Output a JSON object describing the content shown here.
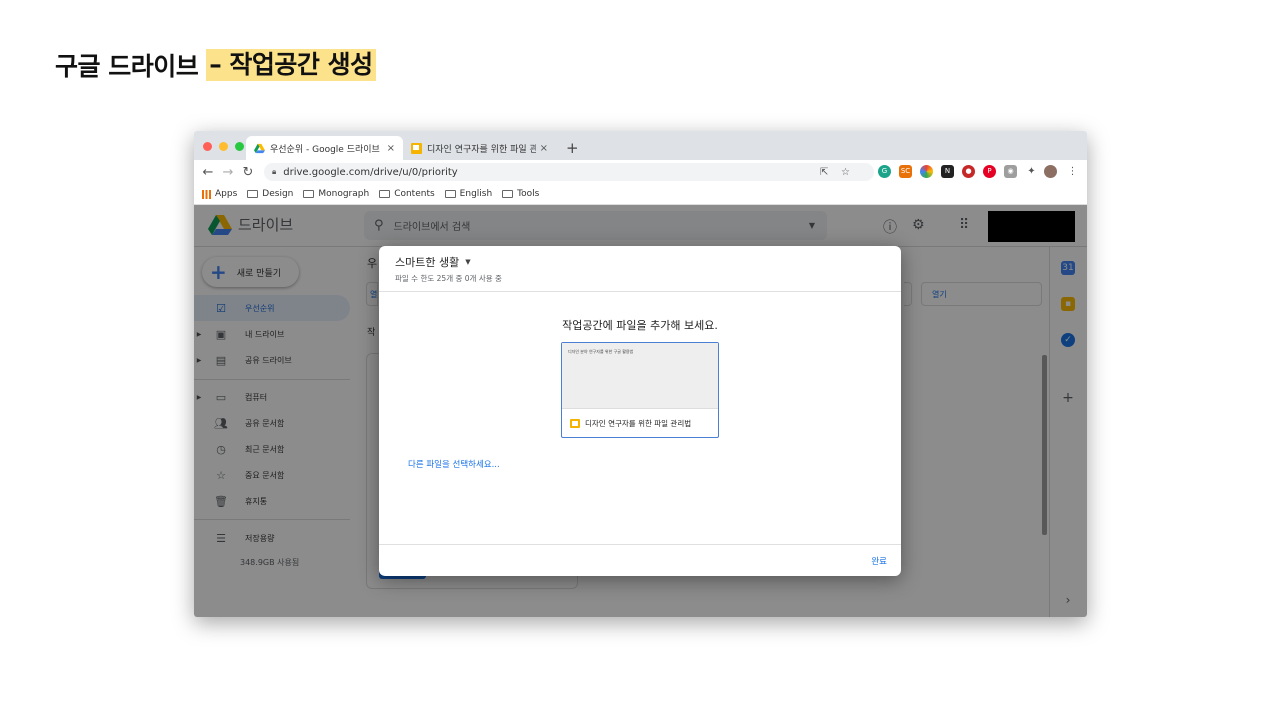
{
  "slide": {
    "title_prefix": "구글 드라이브",
    "title_highlight": "– 작업공간 생성"
  },
  "browser": {
    "tabs": [
      {
        "label": "우선순위 - Google 드라이브",
        "active": true
      },
      {
        "label": "디자인 연구자를 위한 파일 관리법 -",
        "active": false
      }
    ],
    "new_tab": "+",
    "close_glyph": "×",
    "url": "drive.google.com/drive/u/0/priority",
    "bookmarks": [
      "Apps",
      "Design",
      "Monograph",
      "Contents",
      "English",
      "Tools"
    ]
  },
  "drive": {
    "logo_text": "드라이브",
    "search_placeholder": "드라이브에서 검색",
    "new_button": "새로 만들기",
    "nav": [
      {
        "label": "우선순위",
        "icon": "priority-icon",
        "selected": true
      },
      {
        "label": "내 드라이브",
        "icon": "my-drive-icon"
      },
      {
        "label": "공유 드라이브",
        "icon": "shared-drive-icon"
      },
      {
        "label": "컴퓨터",
        "icon": "computer-icon"
      },
      {
        "label": "공유 문서함",
        "icon": "shared-with-me-icon"
      },
      {
        "label": "최근 문서함",
        "icon": "recent-icon"
      },
      {
        "label": "중요 문서함",
        "icon": "starred-icon"
      },
      {
        "label": "휴지통",
        "icon": "trash-icon"
      }
    ],
    "storage_label": "저장용량",
    "storage_used": "348.9GB 사용됨",
    "open_label": "열기",
    "heading_char": "우",
    "row_char": "작",
    "left_open_char": "열"
  },
  "dialog": {
    "workspace_name": "스마트한 생활",
    "subtitle": "파일 수 한도 25개 중 0개 사용 중",
    "prompt": "작업공간에 파일을 추가해 보세요.",
    "thumb_text": "디자인 분야 연구자를 위한 구글 활용법",
    "file_name": "디자인 연구자를 위한 파일 관리법",
    "other_link": "다른 파일을 선택하세요...",
    "done": "완료"
  },
  "colors": {
    "highlight": "#fce28a",
    "link": "#1a73e8",
    "selected_bg": "#e8f0fe",
    "slides_yellow": "#f4b400"
  }
}
